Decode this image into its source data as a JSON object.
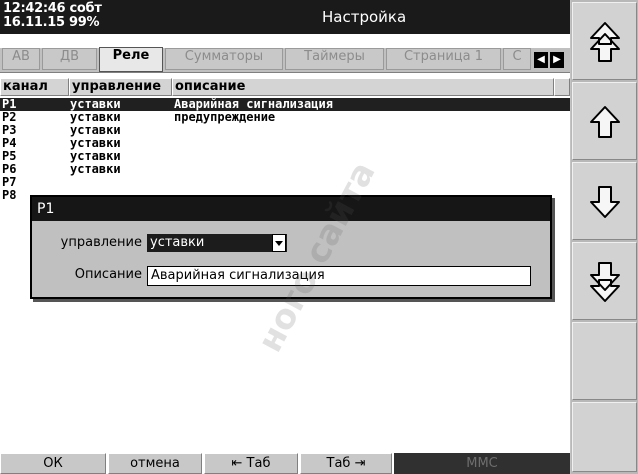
{
  "status": {
    "time": "12:42:46",
    "flag": "собт",
    "date": "16.11.15",
    "percent": "99%"
  },
  "window_title": "Настройка",
  "tabs": [
    {
      "label": "АВ",
      "active": false
    },
    {
      "label": "ДВ",
      "active": false
    },
    {
      "label": "Реле",
      "active": true
    },
    {
      "label": "Сумматоры",
      "active": false
    },
    {
      "label": "Таймеры",
      "active": false
    },
    {
      "label": "Страница 1",
      "active": false
    },
    {
      "label": "С",
      "active": false
    }
  ],
  "tab_scroll": {
    "left_icon": "triangle-left-icon",
    "right_icon": "triangle-right-icon"
  },
  "columns": [
    "канал",
    "управление",
    "описание"
  ],
  "rows": [
    {
      "channel": "Р1",
      "control": "уставки",
      "description": "Аварийная сигнализация",
      "selected": true
    },
    {
      "channel": "Р2",
      "control": "уставки",
      "description": "предупреждение",
      "selected": false
    },
    {
      "channel": "Р3",
      "control": "уставки",
      "description": "",
      "selected": false
    },
    {
      "channel": "Р4",
      "control": "уставки",
      "description": "",
      "selected": false
    },
    {
      "channel": "Р5",
      "control": "уставки",
      "description": "",
      "selected": false
    },
    {
      "channel": "Р6",
      "control": "уставки",
      "description": "",
      "selected": false
    },
    {
      "channel": "Р7",
      "control": "",
      "description": "",
      "selected": false
    },
    {
      "channel": "Р8",
      "control": "",
      "description": "",
      "selected": false
    }
  ],
  "dialog": {
    "title": "Р1",
    "control_label": "управление",
    "control_value": "уставки",
    "description_label": "Описание",
    "description_value": "Аварийная сигнализация"
  },
  "bottom_buttons": {
    "ok": "ОК",
    "cancel": "отмена",
    "tab_back": "⇤ Таб",
    "tab_forward": "Таб ⇥",
    "mmc": "ММС"
  },
  "side_buttons": [
    "page-up-icon",
    "arrow-up-icon",
    "arrow-down-icon",
    "page-down-icon",
    "",
    ""
  ],
  "watermark": "ного сайта",
  "colors": {
    "header": "#1a1a1a",
    "selection": "#202020",
    "panel": "#c0c0c0"
  }
}
